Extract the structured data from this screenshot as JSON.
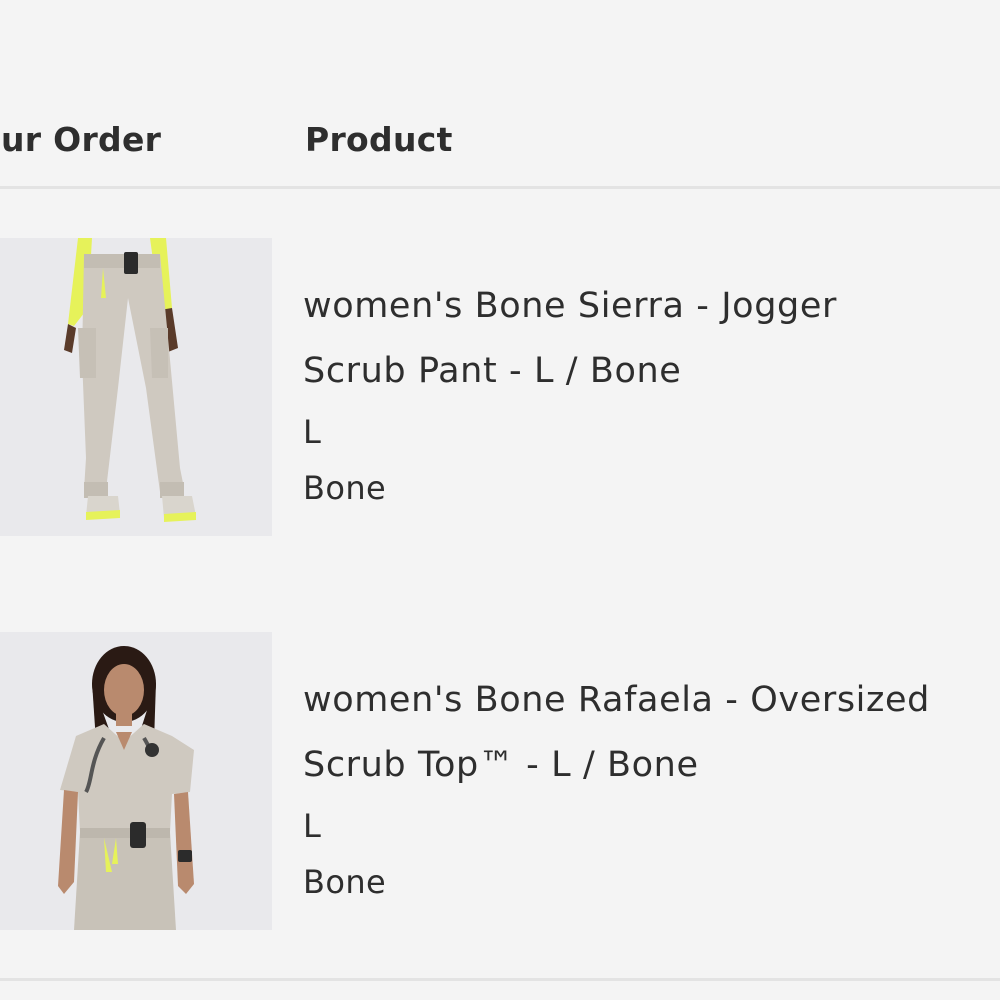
{
  "table": {
    "headers": {
      "order": "our Order",
      "product": "Product"
    }
  },
  "items": [
    {
      "title_line1": "women's Bone Sierra - Jogger",
      "title_line2": "Scrub Pant - L / Bone",
      "size": "L",
      "color": "Bone",
      "image": "jogger-scrub-pant-photo"
    },
    {
      "title_line1": "women's Bone Rafaela - Oversized",
      "title_line2": "Scrub Top™ - L / Bone",
      "size": "L",
      "color": "Bone",
      "image": "oversized-scrub-top-photo"
    }
  ],
  "colors": {
    "background": "#f4f4f4",
    "text": "#2e2e2e",
    "divider": "#e3e3e3",
    "garment_bone": "#cfc9c0",
    "accent_neon": "#e6f25a"
  }
}
